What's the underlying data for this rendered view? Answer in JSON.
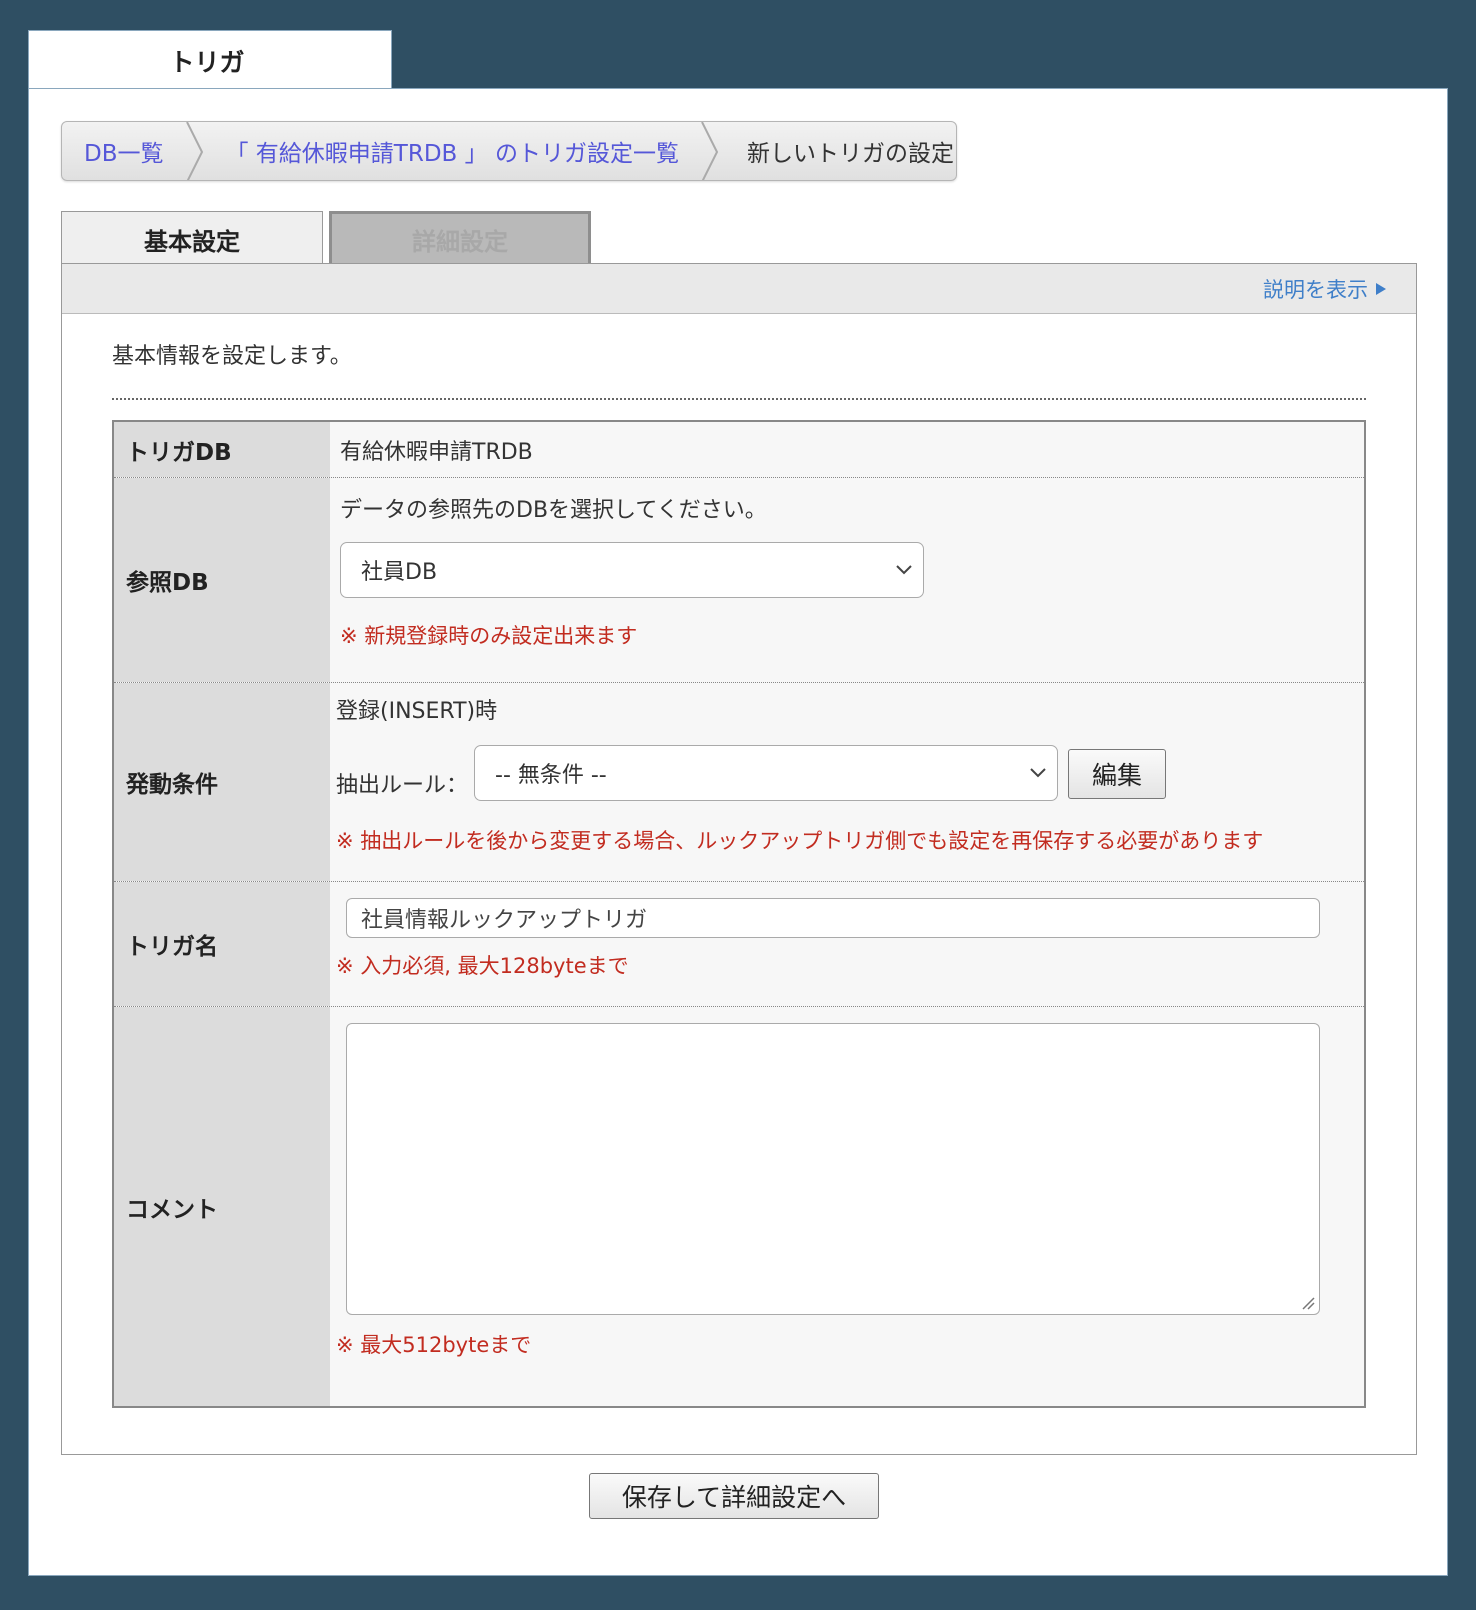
{
  "top_tab": {
    "label": "トリガ"
  },
  "breadcrumb": {
    "items": [
      {
        "label": "DB一覧"
      },
      {
        "label": "「 有給休暇申請TRDB 」 のトリガ設定一覧"
      },
      {
        "label": "新しいトリガの設定"
      }
    ]
  },
  "tabs": [
    {
      "label": "基本設定",
      "active": true
    },
    {
      "label": "詳細設定",
      "active": false
    }
  ],
  "help": {
    "label": "説明を表示"
  },
  "intro": "基本情報を設定します。",
  "form": {
    "trigger_db": {
      "label": "トリガDB",
      "value": "有給休暇申請TRDB"
    },
    "ref_db": {
      "label": "参照DB",
      "instruction": "データの参照先のDBを選択してください。",
      "selected": "社員DB",
      "note": "※ 新規登録時のみ設定出来ます"
    },
    "condition": {
      "label": "発動条件",
      "event": "登録(INSERT)時",
      "rule_label": "抽出ルール：",
      "rule_selected": "-- 無条件 --",
      "edit_button": "編集",
      "note": "※ 抽出ルールを後から変更する場合、ルックアップトリガ側でも設定を再保存する必要があります"
    },
    "trigger_name": {
      "label": "トリガ名",
      "value": "社員情報ルックアップトリガ",
      "note": "※ 入力必須, 最大128byteまで"
    },
    "comment": {
      "label": "コメント",
      "value": "",
      "note": "※ 最大512byteまで"
    }
  },
  "save_button": "保存して詳細設定へ",
  "colors": {
    "background": "#2f4f63",
    "link": "#5557d8",
    "help_link": "#3f7fc9",
    "note": "#c22c20"
  }
}
